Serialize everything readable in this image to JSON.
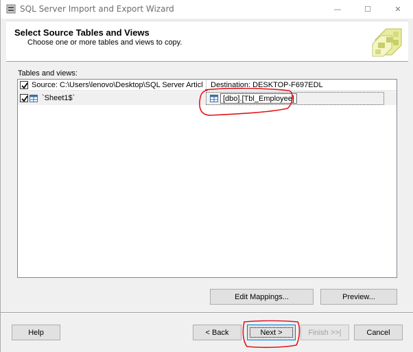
{
  "window": {
    "title": "SQL Server Import and Export Wizard",
    "controls": {
      "minimize": "—",
      "maximize": "☐",
      "close": "✕"
    }
  },
  "header": {
    "title": "Select Source Tables and Views",
    "subtitle": "Choose one or more tables and views to copy."
  },
  "content": {
    "tables_label": "Tables and views:",
    "columns": {
      "source": "Source: C:\\Users\\lenovo\\Desktop\\SQL Server Articl...",
      "destination": "Destination: DESKTOP-F697EDL"
    },
    "rows": [
      {
        "source": "`Sheet1$`",
        "destination": "[dbo].[Tbl_Employee]",
        "checked": true
      }
    ],
    "header_checked": true
  },
  "buttons": {
    "edit_mappings": "Edit Mappings...",
    "preview": "Preview...",
    "help": "Help",
    "back": "< Back",
    "next": "Next >",
    "finish": "Finish >>|",
    "cancel": "Cancel"
  },
  "colors": {
    "annotation": "#e2141b",
    "focus_border": "#0078d7"
  }
}
